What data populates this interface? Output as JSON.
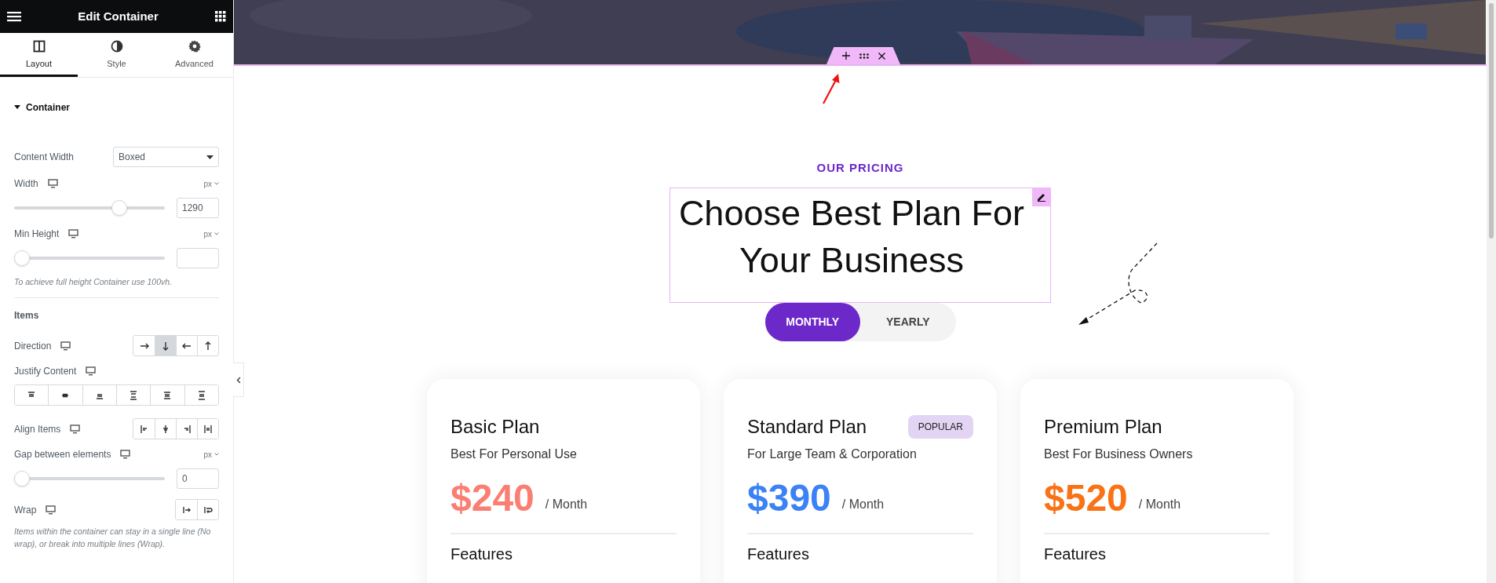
{
  "panel": {
    "title": "Edit Container",
    "tabs": [
      {
        "label": "Layout",
        "selected": true
      },
      {
        "label": "Style",
        "selected": false
      },
      {
        "label": "Advanced",
        "selected": false
      }
    ],
    "section": {
      "title": "Container",
      "expanded": true
    },
    "controls": [
      {
        "kind": "select",
        "label": "Content Width",
        "value": "Boxed"
      },
      {
        "kind": "slider",
        "label": "Width",
        "responsive": true,
        "unit": "px",
        "level": 0.72,
        "value": "1290"
      },
      {
        "kind": "slider",
        "label": "Min Height",
        "responsive": true,
        "unit": "px",
        "level": 0
      },
      {
        "kind": "note",
        "text": "To achieve full height Container use 100vh."
      },
      {
        "kind": "divider"
      },
      {
        "kind": "heading",
        "text": "Items"
      },
      {
        "kind": "direction",
        "label": "Direction",
        "responsive": true,
        "options": [
          {
            "selected": false
          },
          {
            "selected": true
          },
          {
            "selected": false
          },
          {
            "selected": false
          }
        ]
      },
      {
        "kind": "justify",
        "label": "Justify Content",
        "responsive": true,
        "options": [
          {
            "selected": false
          },
          {
            "selected": false
          },
          {
            "selected": false
          },
          {
            "selected": false
          },
          {
            "selected": false
          },
          {
            "selected": false
          }
        ]
      },
      {
        "kind": "align",
        "label": "Align Items",
        "responsive": true,
        "options": [
          {
            "selected": false
          },
          {
            "selected": false
          },
          {
            "selected": false
          },
          {
            "selected": false
          }
        ]
      },
      {
        "kind": "slider",
        "label": "Gap between elements",
        "responsive": true,
        "unit": "px",
        "level": 0,
        "value": "0"
      },
      {
        "kind": "wrap",
        "label": "Wrap",
        "responsive": true,
        "options": [
          {
            "selected": false
          },
          {
            "selected": false
          }
        ]
      },
      {
        "kind": "note",
        "text": "Items within the container can stay in a single line (No wrap), or break into multiple lines (Wrap)."
      }
    ]
  },
  "pricing": {
    "eyebrow": "OUR PRICING",
    "heading": "Choose Best Plan For Your Business",
    "toggle": [
      {
        "label": "MONTHLY",
        "selected": true
      },
      {
        "label": "YEARLY",
        "selected": false
      }
    ],
    "plans": [
      {
        "title": "Basic Plan",
        "subtitle": "Best For Personal Use",
        "price": "$240",
        "period": "/ Month",
        "color": "#fa7f72",
        "features": "Features"
      },
      {
        "title": "Standard Plan",
        "badge": "POPULAR",
        "subtitle": "For Large Team & Corporation",
        "price": "$390",
        "period": "/ Month",
        "color": "#3b82f6",
        "features": "Features"
      },
      {
        "title": "Premium Plan",
        "subtitle": "Best For Business Owners",
        "price": "$520",
        "period": "/ Month",
        "color": "#f97316",
        "features": "Features"
      }
    ]
  }
}
